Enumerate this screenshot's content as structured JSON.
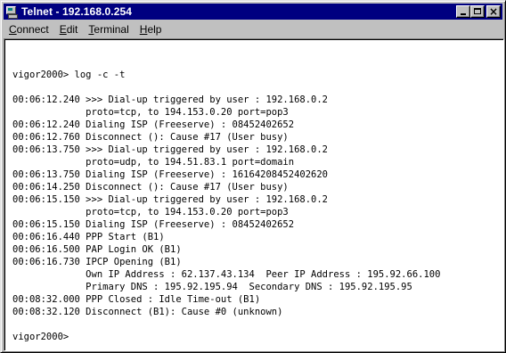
{
  "window": {
    "title": "Telnet - 192.168.0.254",
    "icon": "telnet-computer-icon"
  },
  "title_buttons": {
    "minimize_icon": "minimize-icon",
    "maximize_icon": "maximize-icon",
    "close_icon": "close-icon"
  },
  "menu": {
    "items": [
      {
        "accel": "C",
        "rest": "onnect"
      },
      {
        "accel": "E",
        "rest": "dit"
      },
      {
        "accel": "T",
        "rest": "erminal"
      },
      {
        "accel": "H",
        "rest": "elp"
      }
    ]
  },
  "terminal": {
    "lines": [
      "vigor2000> log -c -t",
      "",
      "00:06:12.240 >>> Dial-up triggered by user : 192.168.0.2",
      "             proto=tcp, to 194.153.0.20 port=pop3",
      "00:06:12.240 Dialing ISP (Freeserve) : 08452402652",
      "00:06:12.760 Disconnect (): Cause #17 (User busy)",
      "00:06:13.750 >>> Dial-up triggered by user : 192.168.0.2",
      "             proto=udp, to 194.51.83.1 port=domain",
      "00:06:13.750 Dialing ISP (Freeserve) : 16164208452402620",
      "00:06:14.250 Disconnect (): Cause #17 (User busy)",
      "00:06:15.150 >>> Dial-up triggered by user : 192.168.0.2",
      "             proto=tcp, to 194.153.0.20 port=pop3",
      "00:06:15.150 Dialing ISP (Freeserve) : 08452402652",
      "00:06:16.440 PPP Start (B1)",
      "00:06:16.500 PAP Login OK (B1)",
      "00:06:16.730 IPCP Opening (B1)",
      "             Own IP Address : 62.137.43.134  Peer IP Address : 195.92.66.100",
      "             Primary DNS : 195.92.195.94  Secondary DNS : 195.92.195.95",
      "00:08:32.000 PPP Closed : Idle Time-out (B1)",
      "00:08:32.120 Disconnect (B1): Cause #0 (unknown)",
      "",
      "vigor2000>"
    ]
  }
}
